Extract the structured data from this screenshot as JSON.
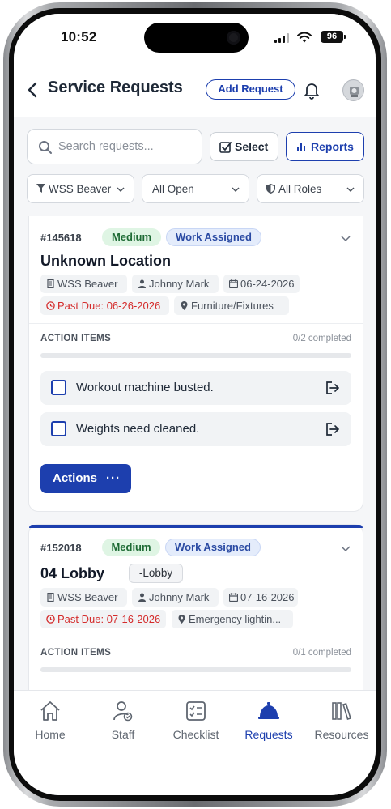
{
  "status_bar": {
    "time": "10:52",
    "battery": "96"
  },
  "header": {
    "title": "Service Requests",
    "add_request_label": "Add Request"
  },
  "toolbar": {
    "search_placeholder": "Search requests...",
    "select_label": "Select",
    "reports_label": "Reports"
  },
  "filters": [
    {
      "label": "WSS Beaver",
      "icon": "filter-icon"
    },
    {
      "label": "All Open"
    },
    {
      "label": "All Roles",
      "icon": "shield-icon"
    }
  ],
  "requests": [
    {
      "id": "#145618",
      "priority": "Medium",
      "status": "Work Assigned",
      "title": "Unknown Location",
      "sublocation": "",
      "site": "WSS Beaver",
      "assignee": "Johnny Mark",
      "date": "06-24-2026",
      "past_due": "Past Due: 06-26-2026",
      "category": "Furniture/Fixtures",
      "action_items_label": "ACTION ITEMS",
      "completed": "0/2 completed",
      "progress": 0,
      "tasks": [
        "Workout machine busted.",
        "Weights need cleaned."
      ],
      "actions_label": "Actions",
      "actions_more": "···"
    },
    {
      "id": "#152018",
      "priority": "Medium",
      "status": "Work Assigned",
      "title": "04 Lobby",
      "sublocation": "-Lobby",
      "site": "WSS Beaver",
      "assignee": "Johnny Mark",
      "date": "07-16-2026",
      "past_due": "Past Due: 07-16-2026",
      "category": "Emergency lightin...",
      "action_items_label": "ACTION ITEMS",
      "completed": "0/1 completed",
      "progress": 0
    }
  ],
  "tabbar": [
    {
      "label": "Home",
      "icon": "home-icon",
      "active": false
    },
    {
      "label": "Staff",
      "icon": "staff-icon",
      "active": false
    },
    {
      "label": "Checklist",
      "icon": "checklist-icon",
      "active": false
    },
    {
      "label": "Requests",
      "icon": "bell-service-icon",
      "active": true
    },
    {
      "label": "Resources",
      "icon": "books-icon",
      "active": false
    }
  ],
  "colors": {
    "accent": "#1d3fae",
    "danger": "#d42b2b",
    "success_bg": "#dff5e4",
    "info_bg": "#e4ecfb"
  }
}
